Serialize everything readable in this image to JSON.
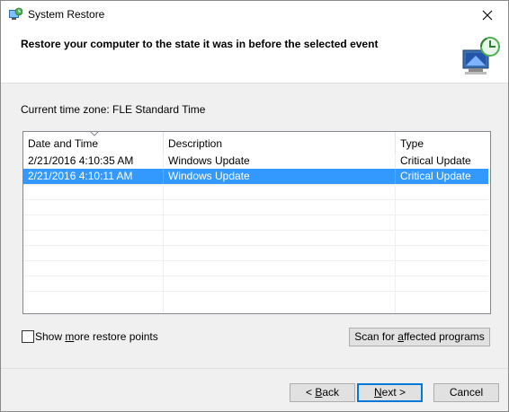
{
  "window": {
    "title": "System Restore"
  },
  "header": {
    "heading": "Restore your computer to the state it was in before the selected event"
  },
  "timezone": "Current time zone: FLE Standard Time",
  "table": {
    "columns": [
      "Date and Time",
      "Description",
      "Type"
    ],
    "rows": [
      {
        "date": "2/21/2016 4:10:35 AM",
        "description": "Windows Update",
        "type": "Critical Update",
        "selected": false
      },
      {
        "date": "2/21/2016 4:10:11 AM",
        "description": "Windows Update",
        "type": "Critical Update",
        "selected": true
      }
    ]
  },
  "checkbox": {
    "label_pre": "Show ",
    "label_accel": "m",
    "label_post": "ore restore points"
  },
  "buttons": {
    "scan_pre": "Scan for ",
    "scan_accel": "a",
    "scan_post": "ffected programs",
    "back_pre": "< ",
    "back_accel": "B",
    "back_post": "ack",
    "next_accel": "N",
    "next_post": "ext >",
    "cancel": "Cancel"
  },
  "icons": {
    "app": "system-restore-icon",
    "header": "restore-monitor-icon",
    "close": "close-icon"
  }
}
